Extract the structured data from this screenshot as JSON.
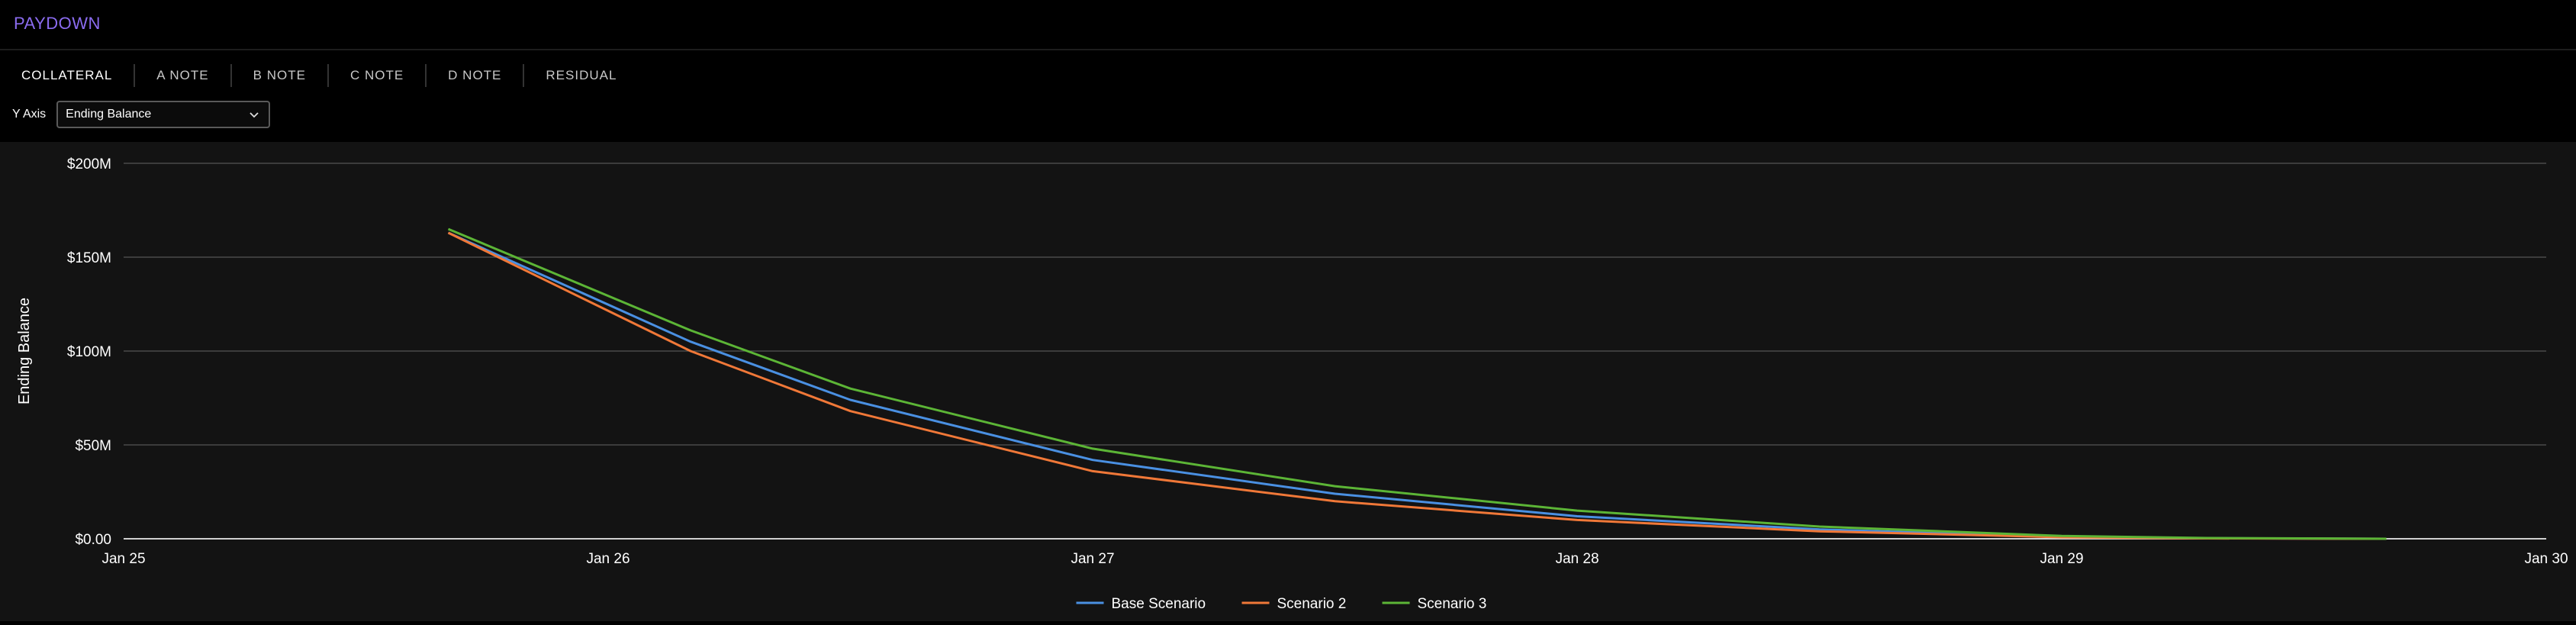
{
  "app": {
    "title": "PAYDOWN"
  },
  "tabs": [
    {
      "label": "COLLATERAL"
    },
    {
      "label": "A NOTE"
    },
    {
      "label": "B NOTE"
    },
    {
      "label": "C NOTE"
    },
    {
      "label": "D NOTE"
    },
    {
      "label": "RESIDUAL"
    }
  ],
  "controls": {
    "yaxis_label": "Y Axis",
    "yaxis_value": "Ending Balance",
    "dropdown_icon": "chevron-down-icon"
  },
  "colors": {
    "accent": "#8b6cf0",
    "base": "#4a90e2",
    "scenario2": "#f07838",
    "scenario3": "#5cb536"
  },
  "chart_data": {
    "type": "line",
    "ylabel": "Ending Balance",
    "xlabel": "",
    "x_ticks": [
      "Jan 25",
      "Jan 26",
      "Jan 27",
      "Jan 28",
      "Jan 29",
      "Jan 30"
    ],
    "y_ticks": [
      "$0.00",
      "$50M",
      "$100M",
      "$150M",
      "$200M"
    ],
    "xlim": [
      2025.0,
      2030.0
    ],
    "ylim": [
      0,
      200
    ],
    "y_units": "$M",
    "grid": true,
    "legend": "bottom-center",
    "series": [
      {
        "name": "Base Scenario",
        "x": [
          2025.67,
          2026.17,
          2026.5,
          2027.0,
          2027.5,
          2028.0,
          2028.5,
          2029.0,
          2029.3,
          2029.67
        ],
        "y": [
          163,
          105,
          74,
          42,
          24,
          12,
          5,
          1,
          0.3,
          0
        ]
      },
      {
        "name": "Scenario 2",
        "x": [
          2025.67,
          2026.17,
          2026.5,
          2027.0,
          2027.5,
          2028.0,
          2028.5,
          2029.0,
          2029.3,
          2029.67
        ],
        "y": [
          163,
          100,
          68,
          36,
          20,
          10,
          4,
          0.8,
          0.2,
          0
        ]
      },
      {
        "name": "Scenario 3",
        "x": [
          2025.67,
          2026.17,
          2026.5,
          2027.0,
          2027.5,
          2028.0,
          2028.5,
          2029.0,
          2029.3,
          2029.67
        ],
        "y": [
          165,
          111,
          80,
          48,
          28,
          15,
          6.5,
          1.5,
          0.4,
          0
        ]
      }
    ]
  }
}
